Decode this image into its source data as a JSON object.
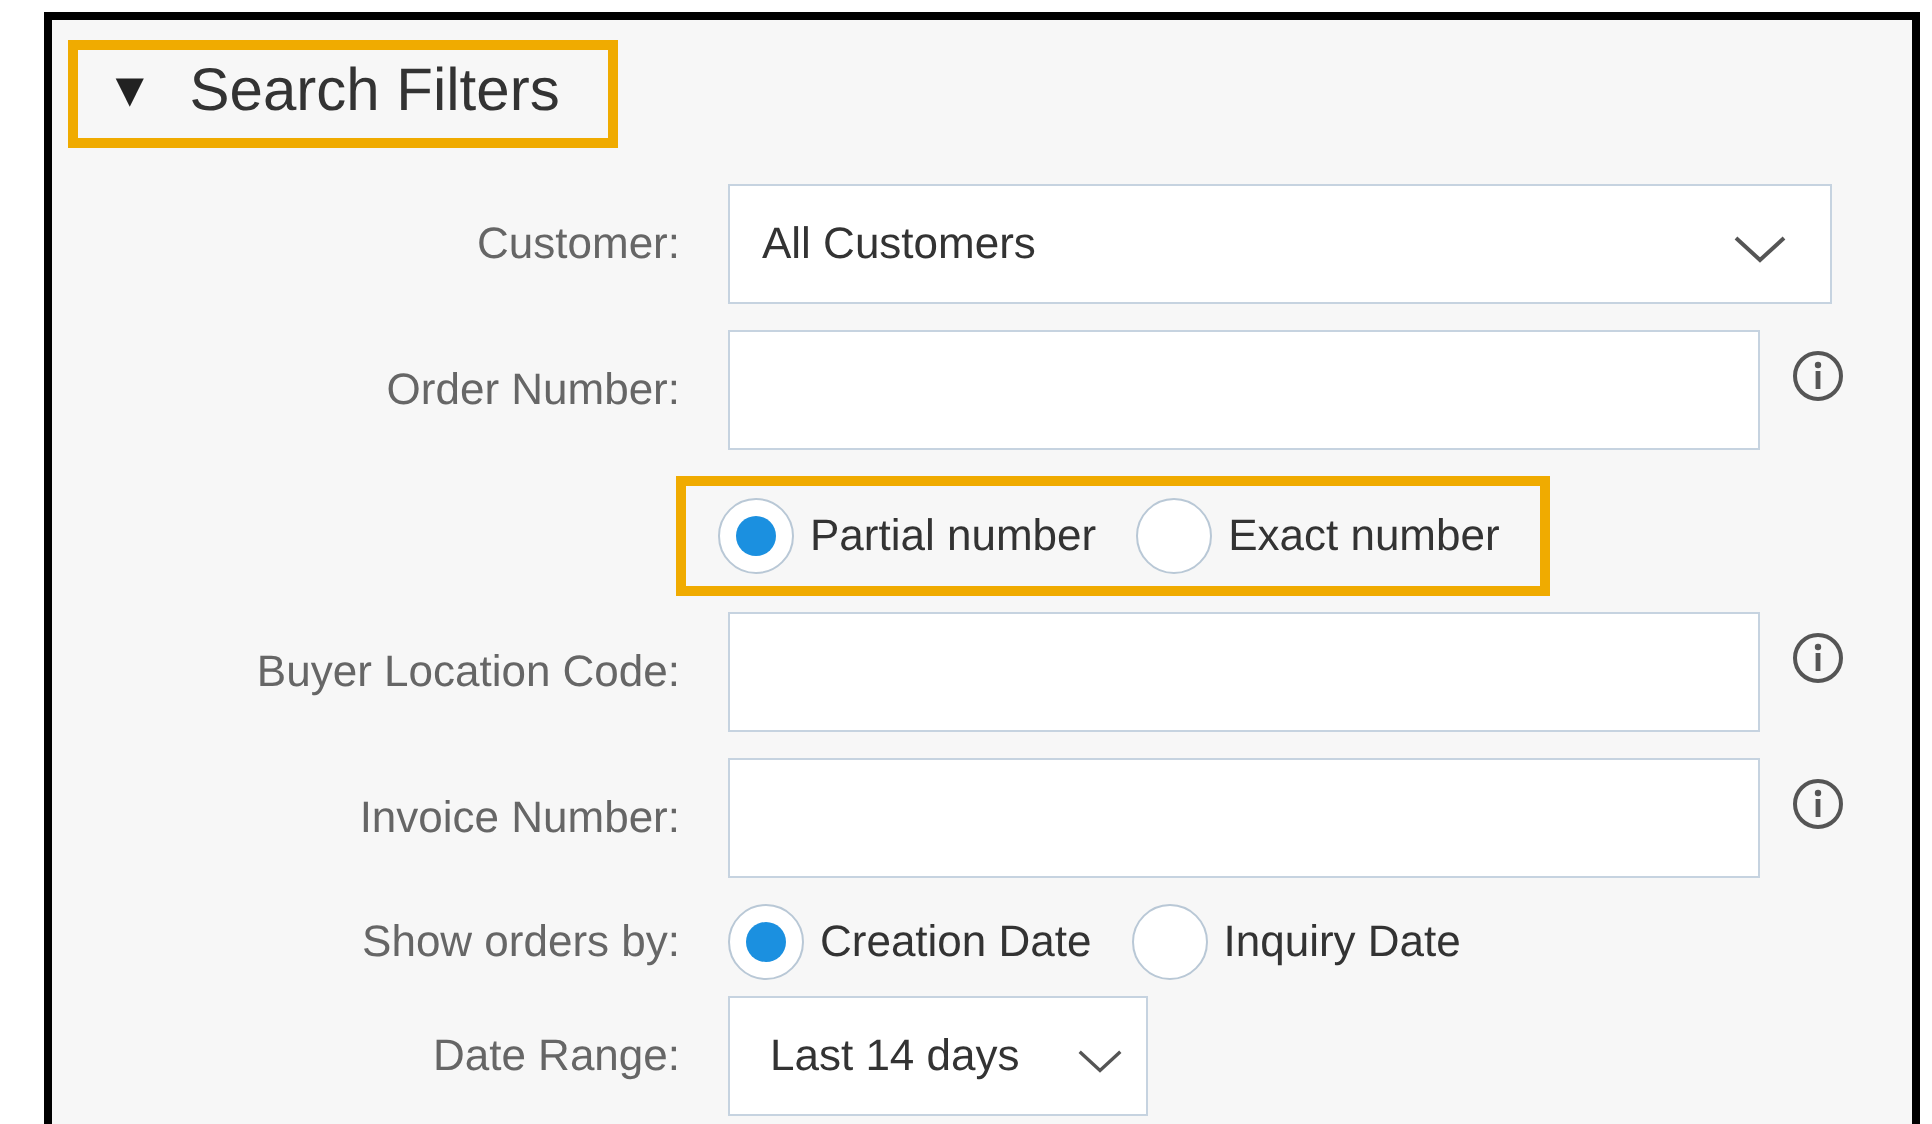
{
  "header": {
    "toggle": "▼",
    "title": "Search Filters",
    "highlighted": true
  },
  "rows": [
    {
      "kind": "select",
      "label": "Customer:",
      "value": "All Customers"
    },
    {
      "kind": "text",
      "label": "Order Number:"
    },
    {
      "kind": "radios",
      "highlighted": true,
      "options": [
        {
          "label": "Partial number",
          "selected": true
        },
        {
          "label": "Exact number",
          "selected": false
        }
      ]
    },
    {
      "kind": "text",
      "label": "Buyer Location Code:"
    },
    {
      "kind": "text",
      "label": "Invoice Number:"
    },
    {
      "kind": "radios",
      "label": "Show orders by:",
      "highlighted": false,
      "options": [
        {
          "label": "Creation Date",
          "selected": true
        },
        {
          "label": "Inquiry Date",
          "selected": false
        }
      ]
    },
    {
      "kind": "small-select",
      "label": "Date Range:",
      "value": "Last 14 days"
    }
  ]
}
